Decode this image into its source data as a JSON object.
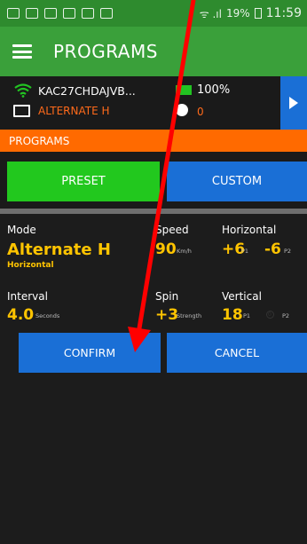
{
  "status_bar": {
    "signal": "ᯤ .ıl",
    "battery": "19%",
    "time": "11:59"
  },
  "app_bar": {
    "title": "PROGRAMS"
  },
  "device": {
    "name": "KAC27CHDAJVB...",
    "program": "ALTERNATE H",
    "battery": "100%",
    "ball_count": "0"
  },
  "section": {
    "title": "PROGRAMS"
  },
  "tabs": {
    "preset": "PRESET",
    "custom": "CUSTOM"
  },
  "settings": {
    "mode_label": "Mode",
    "mode_value": "Alternate H",
    "mode_sub": "Horizontal",
    "speed_label": "Speed",
    "speed_value": "90",
    "speed_unit": "Km/h",
    "horizontal_label": "Horizontal",
    "horizontal_p1": "+6",
    "horizontal_p1_unit": "P1",
    "horizontal_p2": "-6",
    "horizontal_p2_unit": "P2",
    "interval_label": "Interval",
    "interval_value": "4.0",
    "interval_unit": "Seconds",
    "spin_label": "Spin",
    "spin_value": "+3",
    "spin_unit": "Strength",
    "vertical_label": "Vertical",
    "vertical_p1": "18",
    "vertical_p1_unit": "P1",
    "vertical_p2": "0",
    "vertical_p2_unit": "P2"
  },
  "actions": {
    "confirm": "CONFIRM",
    "cancel": "CANCEL"
  },
  "colors": {
    "app_green": "#3aa03a",
    "status_green": "#2e8b2e",
    "preset_green": "#22c81e",
    "action_blue": "#1a6fd6",
    "section_orange": "#ff6a00",
    "value_yellow": "#ffc400",
    "annotation_red": "#ff0000"
  }
}
